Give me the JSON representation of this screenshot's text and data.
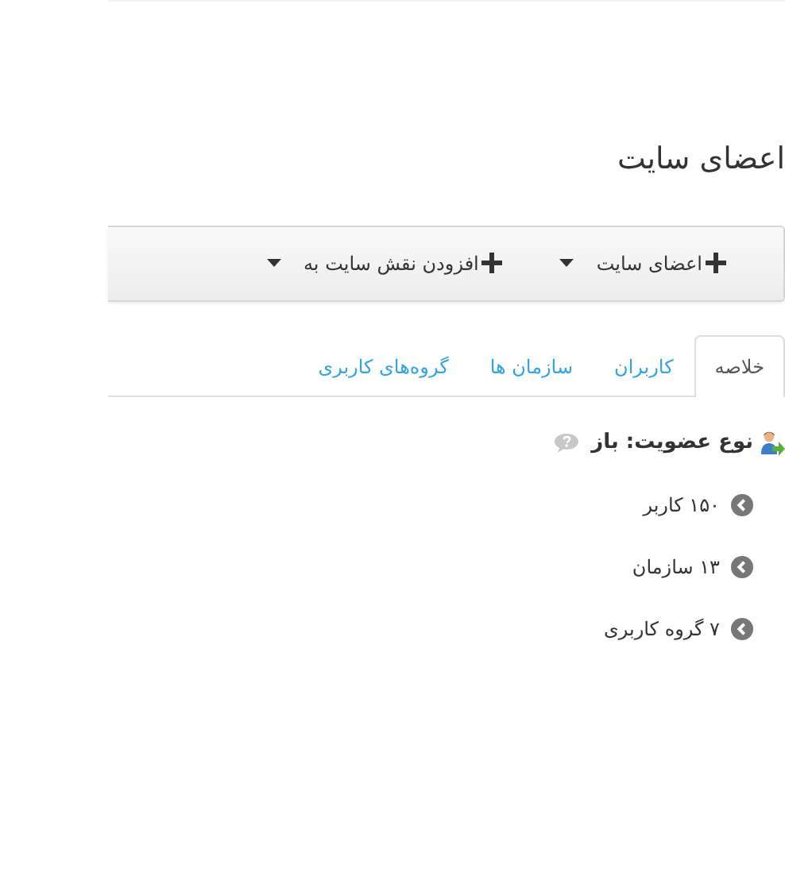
{
  "page": {
    "title": "اعضای سایت"
  },
  "toolbar": [
    {
      "label": "اعضای سایت"
    },
    {
      "label": "افزودن نقش سایت به"
    }
  ],
  "tabs": [
    {
      "label": "خلاصه",
      "selected": true
    },
    {
      "label": "کاربران",
      "selected": false
    },
    {
      "label": "سازمان ها",
      "selected": false
    },
    {
      "label": "گروه‌های کاربری",
      "selected": false
    }
  ],
  "membership": {
    "label": "نوع عضویت: باز"
  },
  "stats": [
    {
      "label": "۱۵۰ کاربر"
    },
    {
      "label": "۱۳ سازمان"
    },
    {
      "label": "۷ گروه کاربری"
    }
  ]
}
